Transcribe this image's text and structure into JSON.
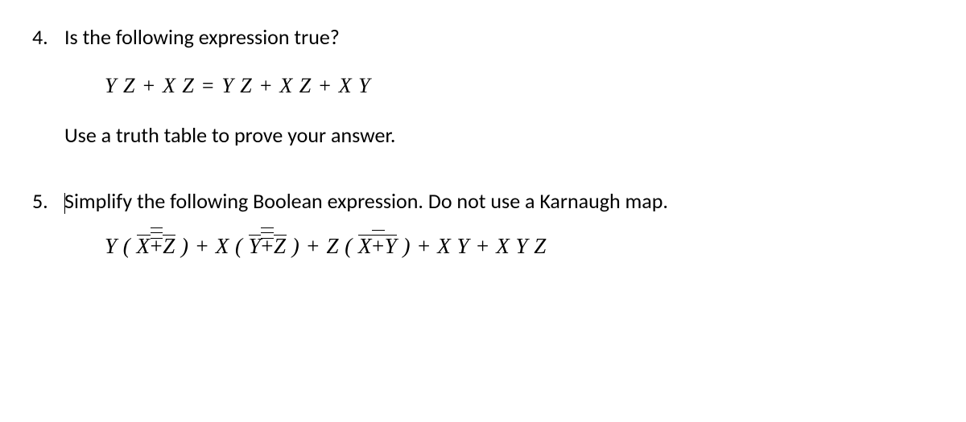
{
  "problem4": {
    "number": "4.",
    "question": "Is the following expression true?",
    "expression": "Y Z + X  Z = Y Z + X  Z + X Y",
    "instruction": "Use a truth table to prove your answer."
  },
  "problem5": {
    "number": "5.",
    "question_before_cursor": "",
    "question_after_cursor": "Simplify the following Boolean expression. Do not use a Karnaugh map.",
    "expression_parts": {
      "p1": "Y ( ",
      "xbar1": "X",
      "plus_triple1": "+",
      "zneg1": "Z",
      "p2": " ) +  X ( ",
      "ybar1": "Y",
      "plus_triple2": "+",
      "zneg2": "Z",
      "p3": " ) +  Z ( ",
      "xbar2": "X",
      "plus_double": "+",
      "ybar2": "Y",
      "p4": " ) + X Y + X Y Z"
    }
  },
  "chart_data": {
    "type": "document",
    "problems": [
      {
        "number": 4,
        "prompt": "Is the following expression true?",
        "equation_lhs": "Y Z + X Z",
        "equation_rhs": "Y Z + X Z + X Y",
        "followup": "Use a truth table to prove your answer."
      },
      {
        "number": 5,
        "prompt": "Simplify the following Boolean expression. Do not use a Karnaugh map.",
        "expression": "Y( X̄ +̄ Z̄ ) + X( Ȳ +̄ Z̄ ) + Z( X̄ +̄ Ȳ ) + XY + XYZ",
        "notes": "Overbars present on variables and plus signs; some plus signs carry multiple overbars (De Morgan style negation)."
      }
    ]
  }
}
